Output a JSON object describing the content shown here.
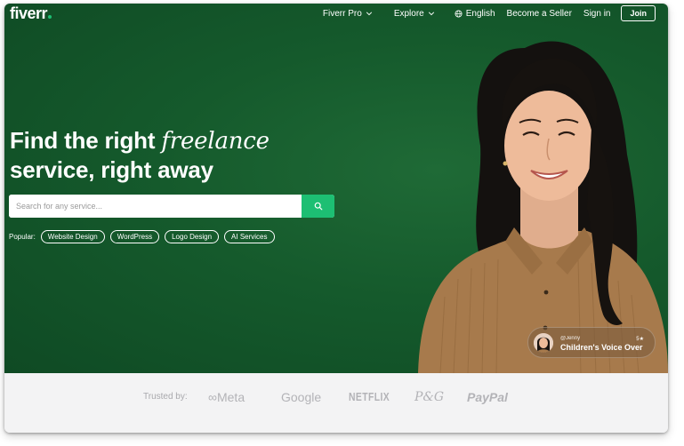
{
  "brand": {
    "logo_text": "fiverr",
    "accent_color": "#1dbf73",
    "hero_color": "#155a2c"
  },
  "nav": {
    "items": [
      {
        "label": "Fiverr Pro",
        "icon": "chevron-down-icon"
      },
      {
        "label": "Explore",
        "icon": "chevron-down-icon"
      },
      {
        "label": "English",
        "icon": "globe-icon"
      },
      {
        "label": "Become a Seller"
      },
      {
        "label": "Sign in"
      }
    ],
    "join_label": "Join"
  },
  "hero": {
    "headline_line1_prefix": "Find the right",
    "headline_line1_emphasis": "freelance",
    "headline_line2": "service, right away"
  },
  "search": {
    "placeholder": "Search for any service...",
    "value": "",
    "button_icon": "search-icon"
  },
  "popular": {
    "label": "Popular:",
    "chips": [
      "Website Design",
      "WordPress",
      "Logo Design",
      "AI Services"
    ]
  },
  "profile_card": {
    "handle": "@Jenny",
    "title": "Children's Voice Over",
    "rating": "5★"
  },
  "trusted": {
    "label": "Trusted by:",
    "brands": [
      "Meta",
      "Google",
      "NETFLIX",
      "P&G",
      "PayPal"
    ]
  }
}
